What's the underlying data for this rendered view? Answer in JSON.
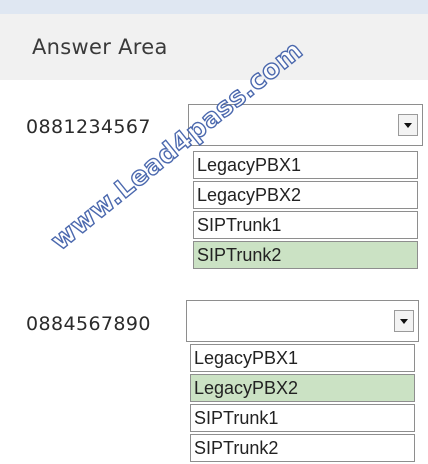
{
  "answer_area": {
    "title": "Answer Area"
  },
  "rows": [
    {
      "phone": "0881234567",
      "selected_value": "",
      "options": [
        "LegacyPBX1",
        "LegacyPBX2",
        "SIPTrunk1",
        "SIPTrunk2"
      ],
      "highlighted_option": "SIPTrunk2"
    },
    {
      "phone": "0884567890",
      "selected_value": "",
      "options": [
        "LegacyPBX1",
        "LegacyPBX2",
        "SIPTrunk1",
        "SIPTrunk2"
      ],
      "highlighted_option": "LegacyPBX2"
    }
  ],
  "watermark": {
    "text": "www.Lead4pass.com"
  },
  "colors": {
    "header_strip": "#dfe7f2",
    "answer_area_bg": "#f1f1f1",
    "selected_option_bg": "#cbe2c4",
    "watermark_outline": "#3d5da8"
  }
}
